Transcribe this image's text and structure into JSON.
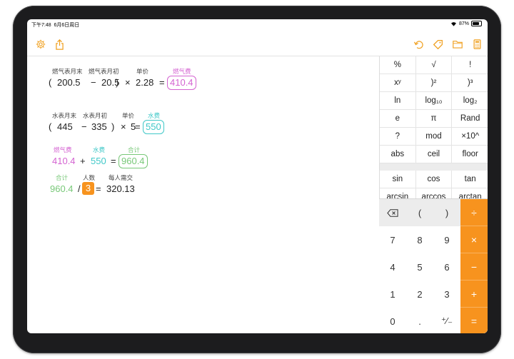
{
  "status": {
    "time": "下午7:48",
    "date": "6月6日周日",
    "battery": "87%"
  },
  "toolbar": {
    "left_icons": [
      "gear-icon",
      "share-icon"
    ],
    "right_icons": [
      "undo-icon",
      "tag-icon",
      "folder-icon",
      "calculator-icon"
    ]
  },
  "rows": [
    {
      "labels": [
        "燃气表月末",
        "燃气表月初",
        "单价",
        "燃气费"
      ],
      "open": "(",
      "a": "200.5",
      "minus": "−",
      "b": "20.5",
      "close": ")",
      "times": "×",
      "c": "2.28",
      "eq": "=",
      "result": "410.4"
    },
    {
      "labels": [
        "水表月末",
        "水表月初",
        "单价",
        "水费"
      ],
      "open": "(",
      "a": "445",
      "minus": "−",
      "b": "335",
      "close": ")",
      "times": "×",
      "c": "5",
      "eq": "=",
      "result": "550"
    },
    {
      "labels": [
        "燃气费",
        "水费",
        "合计"
      ],
      "a": "410.4",
      "plus": "+",
      "b": "550",
      "eq": "=",
      "result": "960.4"
    },
    {
      "labels": [
        "合计",
        "人数",
        "每人需交"
      ],
      "a": "960.4",
      "div": "/",
      "b": "3",
      "eq": "=",
      "result": "320.13"
    }
  ],
  "functions_top": [
    "%",
    "√",
    "!",
    "xʸ",
    ")²",
    ")³",
    "ln",
    "log₁₀",
    "log₂",
    "e",
    "π",
    "Rand",
    "?",
    "mod",
    "×10^",
    "abs",
    "ceil",
    "floor"
  ],
  "functions_bottom": [
    "sin",
    "cos",
    "tan",
    "arcsin",
    "arccos",
    "arctan"
  ],
  "keypad": [
    "⌫",
    "(",
    ")",
    "÷",
    "7",
    "8",
    "9",
    "×",
    "4",
    "5",
    "6",
    "−",
    "1",
    "2",
    "3",
    "+",
    "0",
    ".",
    "⁺∕₋",
    "="
  ],
  "colors": {
    "accent": "#f7931e",
    "pink": "#d463d1",
    "teal": "#40c8c8",
    "green": "#78c878"
  }
}
